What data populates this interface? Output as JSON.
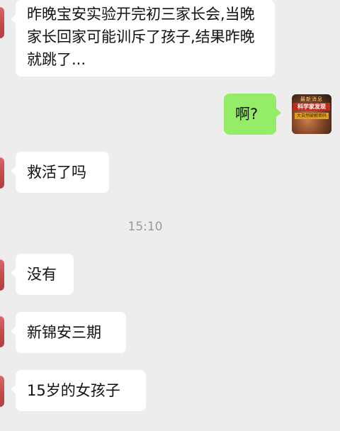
{
  "messages": [
    {
      "side": "left",
      "text": "昨晚宝安实验开完初三家长会,当晚家长回家可能训斥了孩子,结果昨晚就跳了..."
    },
    {
      "side": "right",
      "text": "啊?"
    },
    {
      "side": "left",
      "text": "救活了吗"
    },
    {
      "side": "left",
      "text": "没有"
    },
    {
      "side": "left",
      "text": "新锦安三期"
    },
    {
      "side": "left",
      "text": "15岁的女孩子"
    }
  ],
  "timestamp": "15:10",
  "avatar_right": {
    "top_text": "最新消息",
    "mid_text": "科学家发现",
    "low_text": "大自然破解密码"
  },
  "colors": {
    "background": "#ededed",
    "bubble_left": "#ffffff",
    "bubble_right": "#95ec69",
    "timestamp": "#9a9a9a"
  }
}
